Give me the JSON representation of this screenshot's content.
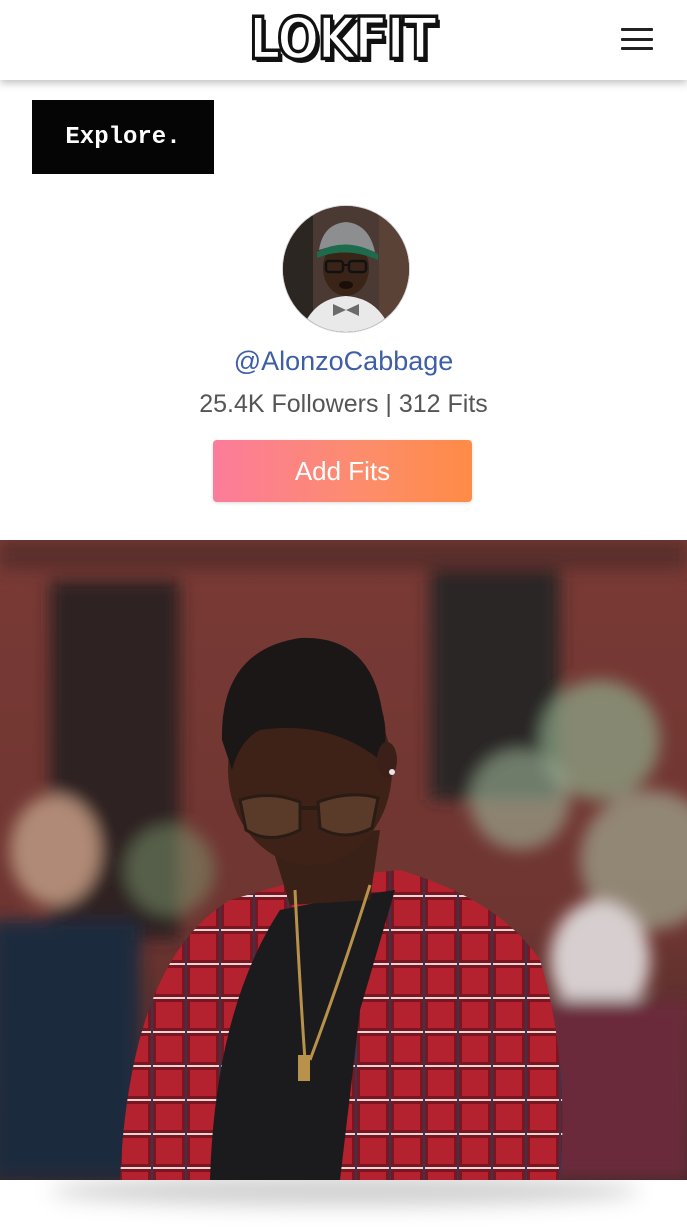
{
  "header": {
    "logo_text": "LOKFIT",
    "menu_icon": "hamburger-menu-icon"
  },
  "explore_label": "Explore.",
  "profile": {
    "username": "@AlonzoCabbage",
    "stats": "25.4K Followers | 312 Fits",
    "add_button_label": "Add Fits"
  },
  "colors": {
    "username_link": "#3f5ea8",
    "button_gradient_start": "#fb7c9b",
    "button_gradient_end": "#fe8b45",
    "explore_bg": "#050505"
  }
}
